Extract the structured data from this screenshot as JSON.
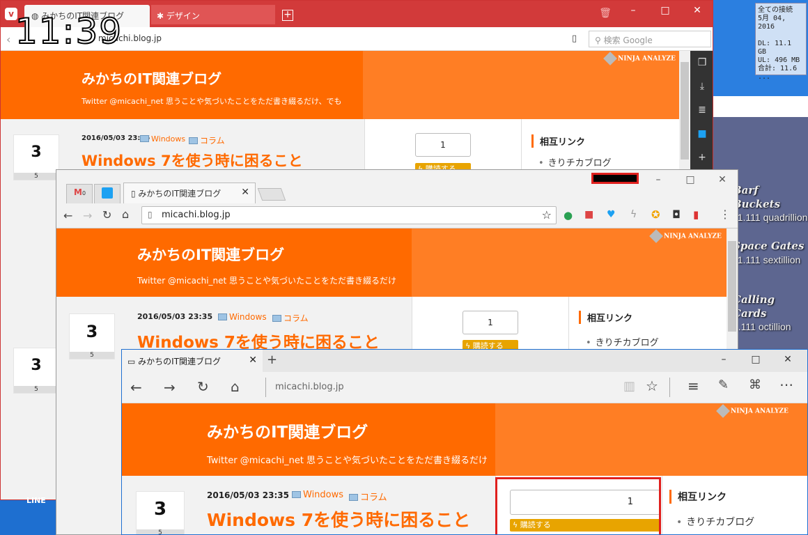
{
  "clock": "11:39",
  "widget": {
    "l1": "全ての接続",
    "l2": "5月 04, 2016",
    "l3": "DL: 11.1 GB",
    "l4": "UL: 496 MB",
    "l5": "合計: 11.6 ..."
  },
  "game": [
    {
      "name": "Barf Buckets",
      "value": "11.111 quadrillion"
    },
    {
      "name": "Space Gates",
      "value": "11.111 sextillion"
    },
    {
      "name": "Calling Cards",
      "value": "1.111 octillion"
    }
  ],
  "desktop_label": "LINE",
  "blog": {
    "title": "みかちのIT関連ブログ",
    "subtitle": "Twitter @micachi_net 思うことや気づいたことをただ書き綴るだけ、でも",
    "subtitle_short": "Twitter @micachi_net 思うことや気づいたことをただ書き綴るだけ",
    "ninja": "NINJA ANALYZE",
    "day": "3",
    "month": "5",
    "date": "2016/05/03 23:35",
    "cat1": "Windows",
    "cat2": "コラム",
    "post_title": "Windows 7を使う時に困ること",
    "count": "1",
    "subscribe": "ϟ 購読する",
    "side_heading": "相互リンク",
    "side_item": "きりチカブログ"
  },
  "vivaldi": {
    "tab1": "みかちのIT関連ブログ",
    "tab2": "デザイン",
    "url": "micachi.blog.jp",
    "search_placeholder": "検索 Google"
  },
  "chrome": {
    "tab1": "みかちのIT関連ブログ",
    "gmail_badge": "0",
    "url": "micachi.blog.jp"
  },
  "edge": {
    "tab1": "みかちのIT関連ブログ",
    "url": "micachi.blog.jp"
  }
}
